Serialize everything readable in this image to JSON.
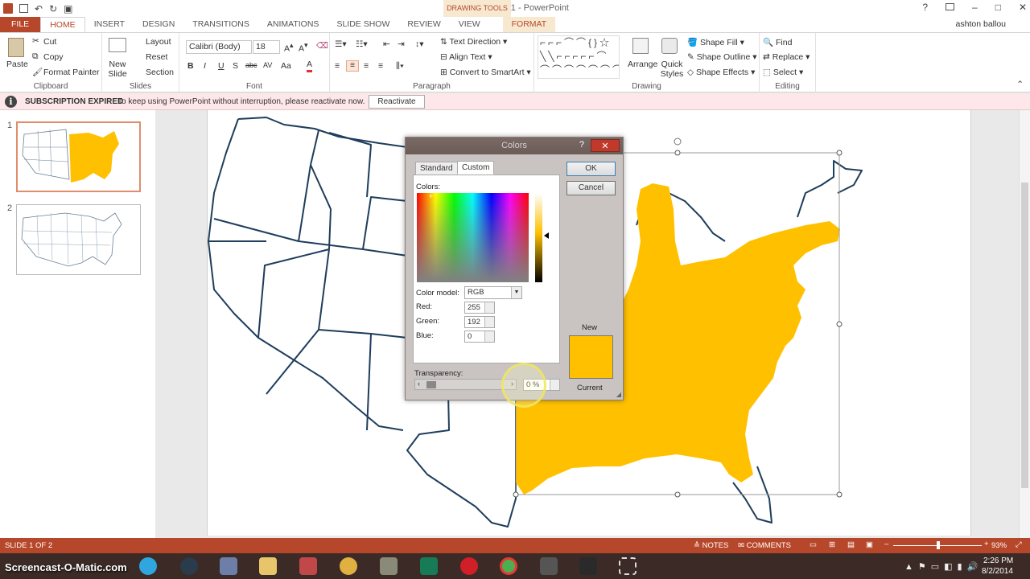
{
  "window": {
    "title": "Presentation1 - PowerPoint",
    "contextual_group": "DRAWING TOOLS",
    "help": "?",
    "minimize": "–",
    "restore": "□",
    "close": "✕"
  },
  "qat": {
    "undo": "↶",
    "redo": "↻",
    "present": "▣"
  },
  "tabs": [
    "FILE",
    "HOME",
    "INSERT",
    "DESIGN",
    "TRANSITIONS",
    "ANIMATIONS",
    "SLIDE SHOW",
    "REVIEW",
    "VIEW",
    "FORMAT"
  ],
  "user": "ashton ballou",
  "ribbon": {
    "clipboard": {
      "label": "Clipboard",
      "paste": "Paste",
      "cut": "Cut",
      "copy": "Copy",
      "format_painter": "Format Painter"
    },
    "slides": {
      "label": "Slides",
      "new_slide": "New Slide",
      "layout": "Layout",
      "reset": "Reset",
      "section": "Section"
    },
    "font": {
      "label": "Font",
      "font_name": "Calibri (Body)",
      "font_size": "18",
      "bold": "B",
      "italic": "I",
      "underline": "U",
      "shadow": "S",
      "strike": "abc",
      "spacing": "AV",
      "case": "Aa",
      "color": "A"
    },
    "paragraph": {
      "label": "Paragraph",
      "text_direction": "Text Direction",
      "align_text": "Align Text",
      "convert_smartart": "Convert to SmartArt"
    },
    "drawing": {
      "label": "Drawing",
      "arrange": "Arrange",
      "quick_styles": "Quick Styles",
      "shape_fill": "Shape Fill",
      "shape_outline": "Shape Outline",
      "shape_effects": "Shape Effects"
    },
    "editing": {
      "label": "Editing",
      "find": "Find",
      "replace": "Replace",
      "select": "Select"
    }
  },
  "message": {
    "title": "SUBSCRIPTION EXPIRED",
    "text": "To keep using PowerPoint without interruption, please reactivate now.",
    "button": "Reactivate",
    "icon": "info-icon"
  },
  "thumbnails": [
    {
      "num": "1"
    },
    {
      "num": "2"
    }
  ],
  "dialog": {
    "title": "Colors",
    "tab_standard": "Standard",
    "tab_custom": "Custom",
    "ok": "OK",
    "cancel": "Cancel",
    "colors_label": "Colors:",
    "model_label": "Color model:",
    "model_value": "RGB",
    "red_label": "Red:",
    "red": "255",
    "green_label": "Green:",
    "green": "192",
    "blue_label": "Blue:",
    "blue": "0",
    "transparency_label": "Transparency:",
    "transparency": "0 %",
    "new_label": "New",
    "current_label": "Current",
    "new_color": "#ffc000",
    "current_color": "#ffc000"
  },
  "status": {
    "slide": "SLIDE 1 OF 2",
    "notes": "NOTES",
    "comments": "COMMENTS",
    "zoom": "93%"
  },
  "taskbar": {
    "watermark": "Screencast-O-Matic.com",
    "time": "2:26 PM",
    "date": "8/2/2014"
  },
  "colors": {
    "accent": "#b7472a",
    "fill": "#ffc000",
    "map_stroke": "#1f3d5c"
  }
}
